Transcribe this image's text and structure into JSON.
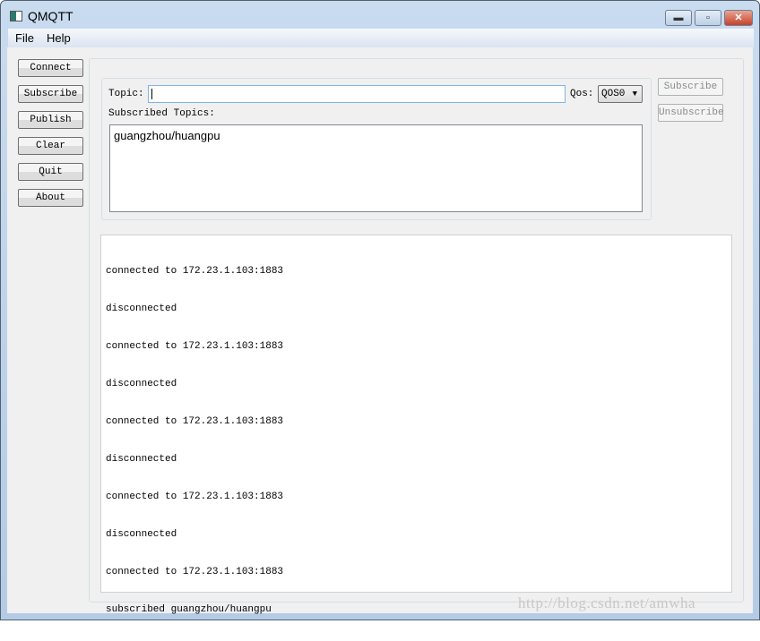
{
  "window": {
    "title": "QMQTT",
    "minimize": "▬",
    "maximize": "▫",
    "close": "✕"
  },
  "menu": [
    "File",
    "Help"
  ],
  "sidebar": {
    "buttons": [
      "Connect",
      "Subscribe",
      "Publish",
      "Clear",
      "Quit",
      "About"
    ]
  },
  "subscribe_panel": {
    "topic_label": "Topic:",
    "topic_value": "",
    "qos_label": "Qos:",
    "qos_value": "QOS0",
    "subscribed_label": "Subscribed Topics:",
    "subscribed_topics": [
      "guangzhou/huangpu"
    ],
    "subscribe_button": "Subscribe",
    "unsubscribe_button": "Unsubscribe"
  },
  "log": [
    "connected to 172.23.1.103:1883",
    "disconnected",
    "connected to 172.23.1.103:1883",
    "disconnected",
    "connected to 172.23.1.103:1883",
    "disconnected",
    "connected to 172.23.1.103:1883",
    "disconnected",
    "connected to 172.23.1.103:1883",
    "subscribed guangzhou/huangpu"
  ],
  "watermark": "http://blog.csdn.net/amwha"
}
